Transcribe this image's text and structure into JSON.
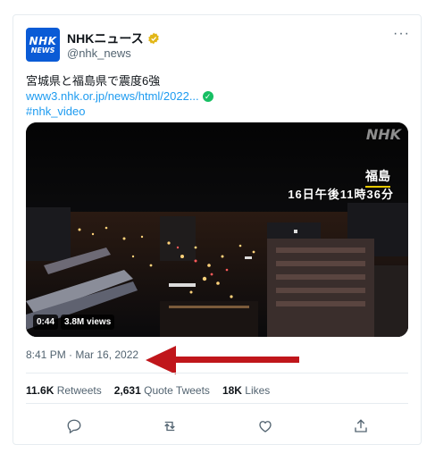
{
  "tweet": {
    "author_name": "NHKニュース",
    "handle": "@nhk_news",
    "avatar_line1": "NHK",
    "avatar_line2": "NEWS",
    "text": "宮城県と福島県で震度6強",
    "link": "www3.nhk.or.jp/news/html/2022...",
    "hashtag": "#nhk_video",
    "more_icon": "more-icon"
  },
  "media": {
    "broadcaster": "NHK",
    "location": "福島",
    "time": "16日午後11時36分",
    "duration": "0:44",
    "views": "3.8M views"
  },
  "date": "8:41 PM · Mar 16, 2022",
  "stats": {
    "retweets_count": "11.6K",
    "retweets_label": "Retweets",
    "quotes_count": "2,631",
    "quotes_label": "Quote Tweets",
    "likes_count": "18K",
    "likes_label": "Likes"
  },
  "actions": [
    "reply-icon",
    "retweet-icon",
    "like-icon",
    "share-icon"
  ],
  "colors": {
    "link": "#1d9bf0",
    "arrow": "#c0161b",
    "avatar": "#0a5bd6"
  }
}
